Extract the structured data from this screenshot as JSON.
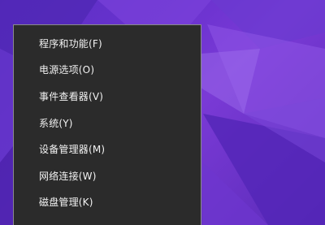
{
  "context_menu": {
    "items": [
      {
        "label": "程序和功能(F)"
      },
      {
        "label": "电源选项(O)"
      },
      {
        "label": "事件查看器(V)"
      },
      {
        "label": "系统(Y)"
      },
      {
        "label": "设备管理器(M)"
      },
      {
        "label": "网络连接(W)"
      },
      {
        "label": "磁盘管理(K)"
      }
    ]
  },
  "colors": {
    "menu_background": "#2b2b2b",
    "menu_text": "#f2f2f2",
    "menu_border": "#8a8a8a",
    "wallpaper_primary": "#6a32cf"
  }
}
